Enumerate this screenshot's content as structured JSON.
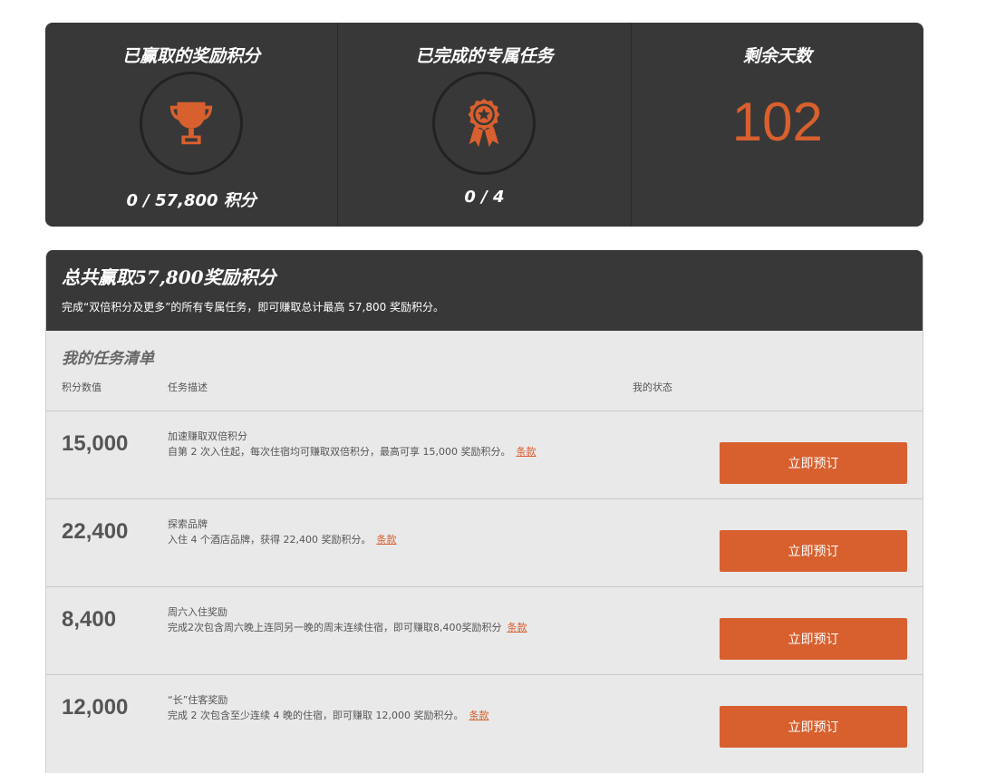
{
  "stats": [
    {
      "title": "已赢取的奖励积分",
      "icon": "trophy-icon",
      "value": "0 / 57,800 积分"
    },
    {
      "title": "已完成的专属任务",
      "icon": "award-badge-icon",
      "value": "0 / 4"
    },
    {
      "title": "剩余天数",
      "value": "102"
    }
  ],
  "summary": {
    "title": "总共赢取57,800奖励积分",
    "subtitle": "完成“双倍积分及更多”的所有专属任务，即可赚取总计最高 57,800 奖励积分。"
  },
  "task_list": {
    "title": "我的任务清单",
    "headers": {
      "points": "积分数值",
      "description": "任务描述",
      "status": "我的状态"
    },
    "tasks": [
      {
        "points": "15,000",
        "name": "加速赚取双倍积分",
        "description": "自第 2 次入住起，每次住宿均可赚取双倍积分，最高可享 15,000 奖励积分。",
        "terms": "条款",
        "button": "立即预订"
      },
      {
        "points": "22,400",
        "name": "探索品牌",
        "description": "入住 4 个酒店品牌，获得 22,400 奖励积分。",
        "terms": "条款",
        "button": "立即预订"
      },
      {
        "points": "8,400",
        "name": "周六入住奖励",
        "description": "完成2次包含周六晚上连同另一晚的周末连续住宿，即可赚取8,400奖励积分",
        "terms": "条款",
        "button": "立即预订"
      },
      {
        "points": "12,000",
        "name": "“长”住客奖励",
        "description": "完成 2 次包含至少连续 4 晚的住宿，即可赚取 12,000 奖励积分。",
        "terms": "条款",
        "button": "立即预订"
      }
    ]
  },
  "colors": {
    "accent": "#d8602f",
    "panel_dark": "#383838",
    "list_bg": "#e9e9e9"
  }
}
